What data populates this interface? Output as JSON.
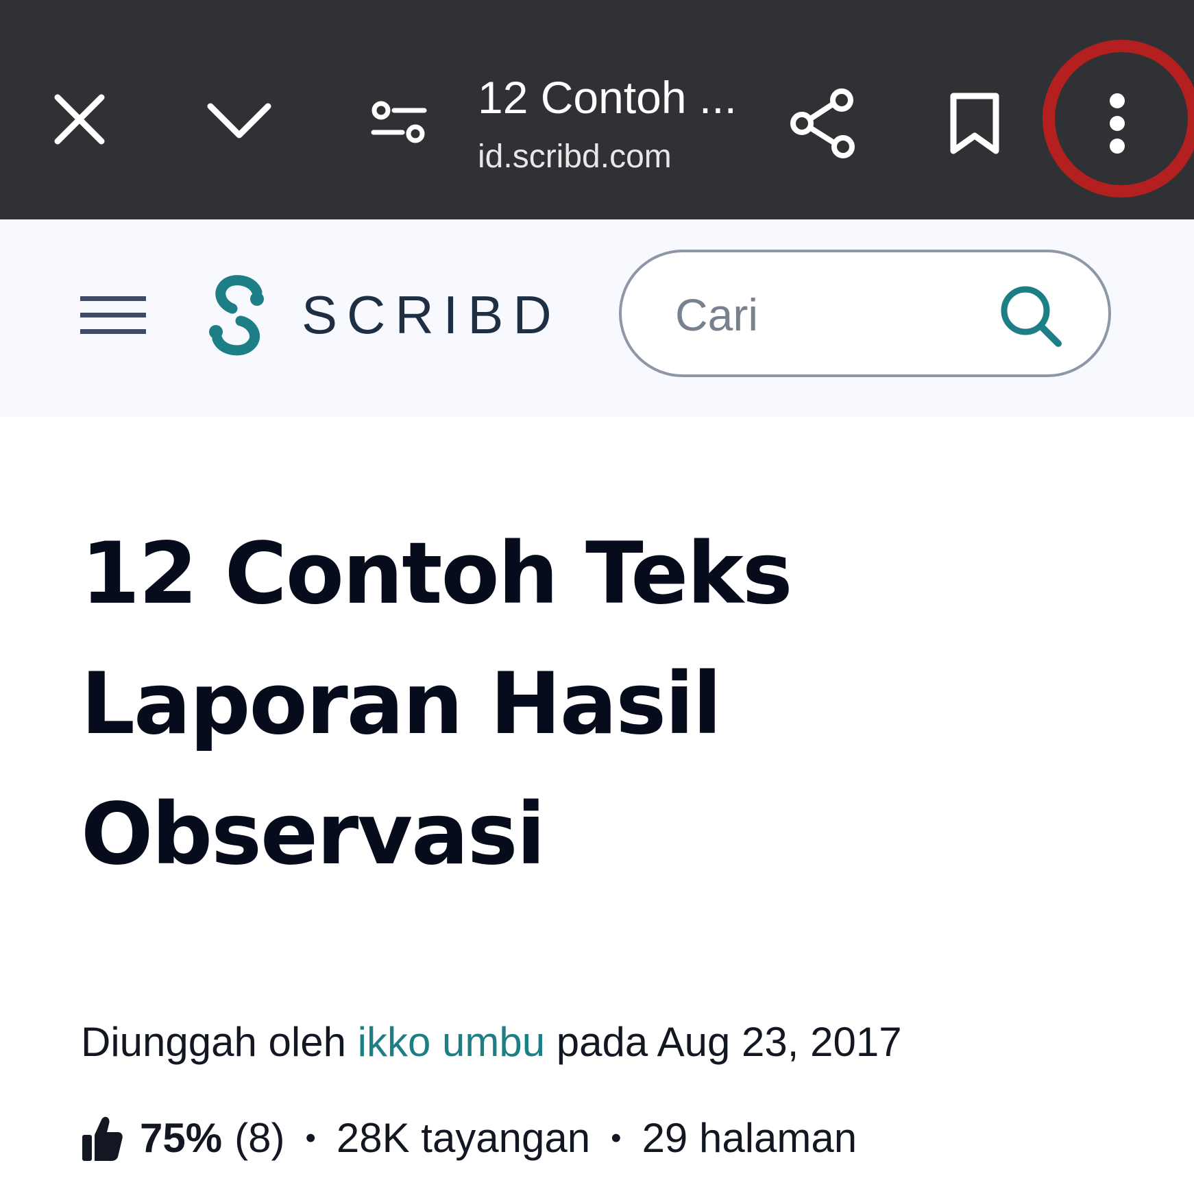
{
  "browser": {
    "tab_title": "12 Contoh ...",
    "url": "id.scribd.com"
  },
  "site": {
    "brand": "SCRIBD",
    "search_placeholder": "Cari",
    "accent_color": "#1d7f85"
  },
  "document": {
    "title": "12 Contoh Teks Laporan Hasil Observasi",
    "uploaded_prefix": "Diunggah oleh ",
    "author": "ikko umbu",
    "uploaded_suffix": " pada Aug 23, 2017",
    "rating_percent": "75%",
    "rating_count": "(8)",
    "views": "28K tayangan",
    "pages": "29 halaman",
    "separator": "•"
  },
  "icons": {
    "close": "close-icon",
    "minimize": "chevron-down-icon",
    "page_settings": "tune-icon",
    "share": "share-icon",
    "bookmark": "bookmark-icon",
    "more": "more-vert-icon",
    "menu": "hamburger-icon",
    "logo": "scribd-logo-icon",
    "search": "search-icon",
    "like": "thumbs-up-icon"
  }
}
